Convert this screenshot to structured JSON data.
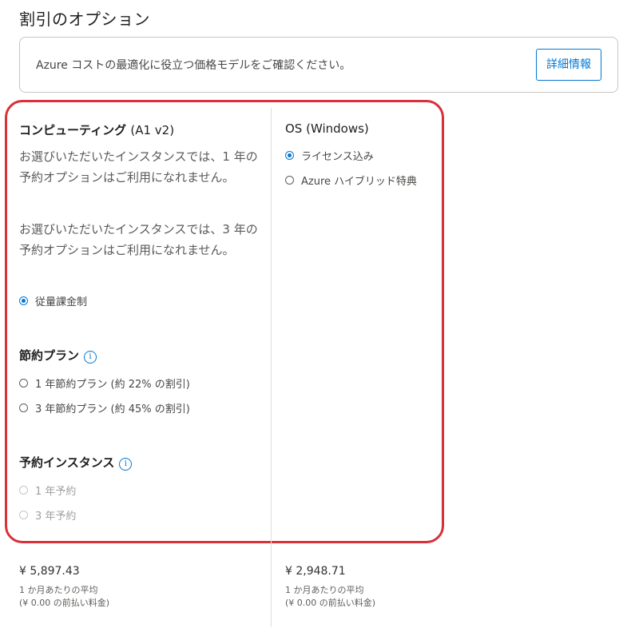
{
  "page_title": "割引のオプション",
  "info_box": {
    "text": "Azure コストの最適化に役立つ価格モデルをご確認ください。",
    "button_label": "詳細情報"
  },
  "compute": {
    "heading": "コンピューティング",
    "sku": "(A1 v2)",
    "note_1yr": "お選びいただいたインスタンスでは、1 年の予約オプションはご利用になれません。",
    "note_3yr": "お選びいただいたインスタンスでは、3 年の予約オプションはご利用になれません。",
    "payg_label": "従量課金制",
    "payg_selected": true
  },
  "savings_plan": {
    "heading": "節約プラン",
    "info_icon": "i",
    "options": [
      {
        "label": "1 年節約プラン (約 22% の割引)",
        "selected": false
      },
      {
        "label": "3 年節約プラン (約 45% の割引)",
        "selected": false
      }
    ]
  },
  "reserved": {
    "heading": "予約インスタンス",
    "info_icon": "i",
    "options": [
      {
        "label": "1 年予約",
        "selected": false,
        "disabled": true
      },
      {
        "label": "3 年予約",
        "selected": false,
        "disabled": true
      }
    ]
  },
  "os": {
    "heading": "OS (Windows)",
    "options": [
      {
        "label": "ライセンス込み",
        "selected": true
      },
      {
        "label": "Azure ハイブリッド特典",
        "selected": false
      }
    ]
  },
  "pricing": {
    "compute": {
      "amount": "¥ 5,897.43",
      "period": "1 か月あたりの平均",
      "upfront": "(¥ 0.00 の前払い料金)"
    },
    "os": {
      "amount": "¥ 2,948.71",
      "period": "1 か月あたりの平均",
      "upfront": "(¥ 0.00 の前払い料金)"
    }
  },
  "colors": {
    "accent": "#0078d4",
    "highlight": "#d8313a",
    "text": "#323130"
  }
}
